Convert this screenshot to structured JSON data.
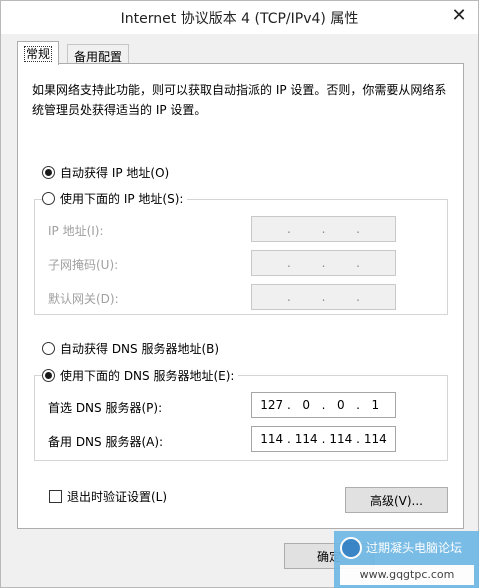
{
  "window": {
    "title": "Internet 协议版本 4 (TCP/IPv4) 属性",
    "close_glyph": "✕"
  },
  "tabs": [
    {
      "label": "常规",
      "active": true
    },
    {
      "label": "备用配置",
      "active": false
    }
  ],
  "general": {
    "description": "如果网络支持此功能，则可以获取自动指派的 IP 设置。否则，你需要从网络系统管理员处获得适当的 IP 设置。",
    "ip_auto_label": "自动获得 IP 地址(O)",
    "ip_manual_label": "使用下面的 IP 地址(S):",
    "ip_auto_selected": true,
    "ip_fields": [
      {
        "label": "IP 地址(I):",
        "octets": [
          "",
          "",
          "",
          ""
        ]
      },
      {
        "label": "子网掩码(U):",
        "octets": [
          "",
          "",
          "",
          ""
        ]
      },
      {
        "label": "默认网关(D):",
        "octets": [
          "",
          "",
          "",
          ""
        ]
      }
    ],
    "dns_auto_label": "自动获得 DNS 服务器地址(B)",
    "dns_manual_label": "使用下面的 DNS 服务器地址(E):",
    "dns_manual_selected": true,
    "dns_fields": [
      {
        "label": "首选 DNS 服务器(P):",
        "octets": [
          "127",
          "0",
          "0",
          "1"
        ]
      },
      {
        "label": "备用 DNS 服务器(A):",
        "octets": [
          "114",
          "114",
          "114",
          "114"
        ]
      }
    ],
    "validate_label": "退出时验证设置(L)",
    "validate_checked": false,
    "advanced_label": "高级(V)..."
  },
  "footer": {
    "ok_label": "确定"
  },
  "watermark": {
    "title": "过期凝头电脑论坛",
    "url": "www.gqgtpc.com"
  }
}
